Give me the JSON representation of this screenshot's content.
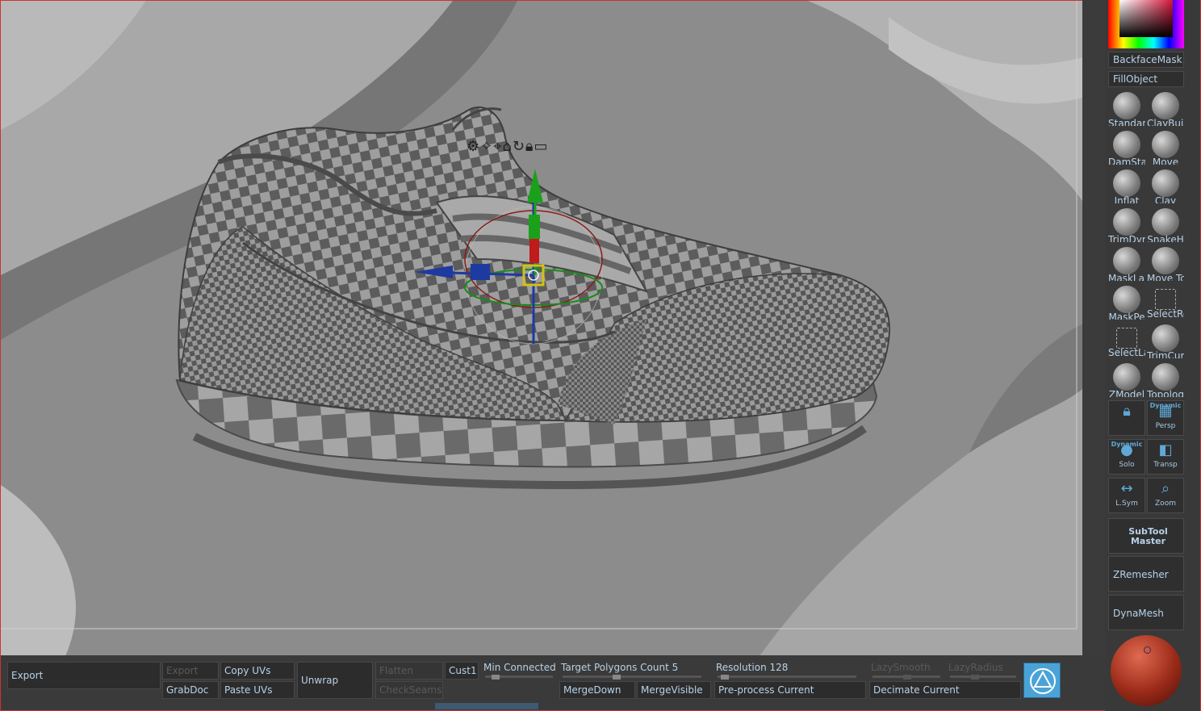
{
  "right_shelf": {
    "backface_mask": "BackfaceMask",
    "fill_object": "FillObject",
    "brushes": [
      {
        "label": "Standar",
        "icon": "standard-brush-icon"
      },
      {
        "label": "ClayBuil",
        "icon": "claybuildup-brush-icon"
      },
      {
        "label": "DamSta",
        "icon": "damstandard-brush-icon"
      },
      {
        "label": "Move",
        "icon": "move-brush-icon"
      },
      {
        "label": "Inflat",
        "icon": "inflate-brush-icon"
      },
      {
        "label": "Clay",
        "icon": "clay-brush-icon"
      },
      {
        "label": "TrimDyr",
        "icon": "trimdynamic-brush-icon"
      },
      {
        "label": "SnakeH",
        "icon": "snakehook-brush-icon"
      },
      {
        "label": "MaskLa:",
        "icon": "masklasso-brush-icon"
      },
      {
        "label": "Move Tc",
        "icon": "movetopological-brush-icon"
      },
      {
        "label": "MaskPe",
        "icon": "maskpen-brush-icon"
      },
      {
        "label": "SelectRe",
        "icon": "selectrect-brush-icon"
      },
      {
        "label": "SelectLa",
        "icon": "selectlasso-brush-icon"
      },
      {
        "label": "TrimCur",
        "icon": "trimcurve-brush-icon"
      },
      {
        "label": "ZModel",
        "icon": "zmodeler-brush-icon"
      },
      {
        "label": "Topolog",
        "icon": "topology-brush-icon"
      }
    ],
    "tools": {
      "lock_label": "",
      "dynamic_label": "Dynamic",
      "persp_label": "Persp",
      "solo_top": "Dynamic",
      "solo_label": "Solo",
      "transp_label": "Transp",
      "lsym_label": "L.Sym",
      "zoom_label": "Zoom"
    },
    "subtool_master_line1": "SubTool",
    "subtool_master_line2": "Master",
    "zremesher": "ZRemesher",
    "dynamesh": "DynaMesh",
    "colors": {
      "material_ball": "#9a2a18",
      "accent": "#4aa3d6"
    }
  },
  "bottom_bar": {
    "export_big": "Export",
    "export_small": "Export",
    "grabdoc": "GrabDoc",
    "copy_uvs": "Copy UVs",
    "paste_uvs": "Paste UVs",
    "unwrap": "Unwrap",
    "flatten": "Flatten",
    "checkseams": "CheckSeams",
    "cust1": "Cust1",
    "min_connected": "Min Connected F",
    "target_polygons": "Target Polygons Count 5",
    "resolution": "Resolution 128",
    "lazysmooth": "LazySmooth",
    "lazyradius": "LazyRadius",
    "mergedown": "MergeDown",
    "mergevisible": "MergeVisible",
    "preprocess": "Pre-process Current",
    "decimate": "Decimate Current"
  }
}
